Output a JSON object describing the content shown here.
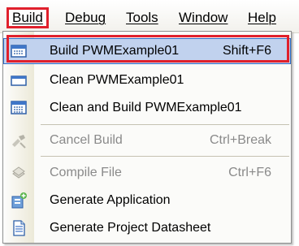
{
  "menubar": {
    "items": [
      {
        "label": "Build"
      },
      {
        "label": "Debug"
      },
      {
        "label": "Tools"
      },
      {
        "label": "Window"
      },
      {
        "label": "Help"
      }
    ]
  },
  "build_menu": {
    "items": [
      {
        "label": "Build PWMExample01",
        "shortcut": "Shift+F6",
        "icon": "build-icon"
      },
      {
        "label": "Clean PWMExample01",
        "shortcut": "",
        "icon": "clean-icon"
      },
      {
        "label": "Clean and Build PWMExample01",
        "shortcut": "",
        "icon": "clean-build-icon"
      },
      {
        "label": "Cancel Build",
        "shortcut": "Ctrl+Break",
        "icon": "cancel-build-icon"
      },
      {
        "label": "Compile File",
        "shortcut": "Ctrl+F6",
        "icon": "compile-file-icon"
      },
      {
        "label": "Generate Application",
        "shortcut": "",
        "icon": "generate-application-icon"
      },
      {
        "label": "Generate Project Datasheet",
        "shortcut": "",
        "icon": "generate-datasheet-icon"
      }
    ]
  },
  "colors": {
    "highlight": "#c1d2ee",
    "callout_border": "#e0202c",
    "disabled_text": "#8a8a8a"
  }
}
